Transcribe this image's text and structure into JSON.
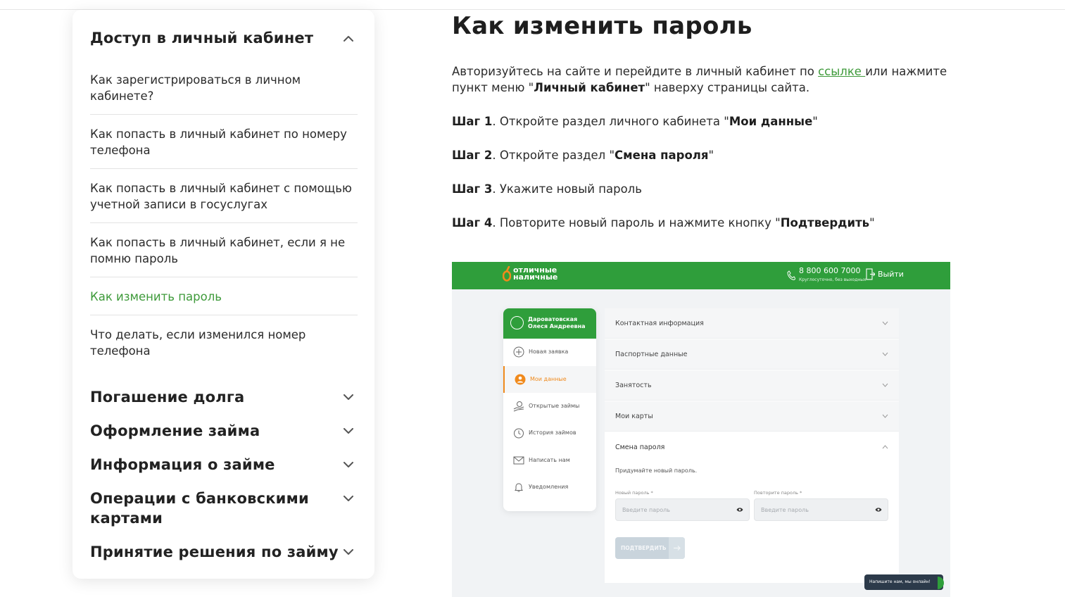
{
  "sidebar": {
    "sections": [
      {
        "title": "Доступ в личный кабинет",
        "expanded": true
      },
      {
        "title": "Погашение долга",
        "expanded": false
      },
      {
        "title": "Оформление займа",
        "expanded": false
      },
      {
        "title": "Информация о займе",
        "expanded": false
      },
      {
        "title": "Операции с банковскими картами",
        "expanded": false
      },
      {
        "title": "Принятие решения по займу",
        "expanded": false
      }
    ],
    "items": [
      {
        "label": "Как зарегистрироваться в личном кабинете?"
      },
      {
        "label": "Как попасть в личный кабинет по номеру телефона"
      },
      {
        "label": "Как попасть в личный кабинет с помощью учетной записи в госуслугах"
      },
      {
        "label": "Как попасть в личный кабинет, если я не помню пароль"
      },
      {
        "label": "Как изменить пароль",
        "active": true
      },
      {
        "label": "Что делать, если изменился номер телефона"
      }
    ]
  },
  "article": {
    "title": "Как изменить пароль",
    "intro_before_link": "Авторизуйтесь на сайте и перейдите в личный кабинет по ",
    "intro_link": "ссылке ",
    "intro_after_link": "или нажмите пункт меню \"",
    "intro_bold": "Личный кабинет",
    "intro_end": "\" наверху страницы сайта.",
    "steps": [
      {
        "label": "Шаг 1",
        "text_before": ". Откройте раздел личного кабинета \"",
        "bold": "Мои данные",
        "text_after": "\""
      },
      {
        "label": "Шаг 2",
        "text_before": ". Откройте раздел \"",
        "bold": "Смена пароля",
        "text_after": "\""
      },
      {
        "label": "Шаг 3",
        "text_before": ". Укажите новый пароль",
        "bold": "",
        "text_after": ""
      },
      {
        "label": "Шаг 4",
        "text_before": ". Повторите новый пароль и нажмите кнопку \"",
        "bold": "Подтвердить",
        "text_after": "\""
      }
    ]
  },
  "screenshot": {
    "logo_line1": "отличные",
    "logo_line2": "наличные",
    "phone": "8 800 600 7000",
    "phone_note": "Круглосуточно, без выходных",
    "logout": "Выйти",
    "user_line1": "Дароватовская",
    "user_line2": "Олеся Андреевна",
    "menu": [
      {
        "label": "Новая заявка",
        "icon": "plus-circle-icon"
      },
      {
        "label": "Мои данные",
        "icon": "user-icon",
        "active": true
      },
      {
        "label": "Открытые займы",
        "icon": "hand-coin-icon"
      },
      {
        "label": "История займов",
        "icon": "history-icon"
      },
      {
        "label": "Написать нам",
        "icon": "mail-icon"
      },
      {
        "label": "Уведомления",
        "icon": "bell-icon"
      }
    ],
    "accordion": [
      {
        "label": "Контактная информация"
      },
      {
        "label": "Паспортные данные"
      },
      {
        "label": "Занятость"
      },
      {
        "label": "Мои карты"
      },
      {
        "label": "Смена пароля",
        "open": true
      }
    ],
    "hint": "Придумайте новый пароль.",
    "new_pw_label": "Новый пароль *",
    "repeat_pw_label": "Повторите пароль *",
    "pw_placeholder": "Введите пароль",
    "confirm_button": "ПОДТВЕРДИТЬ",
    "chat_label": "Напишите нам, мы онлайн!",
    "colors": {
      "brand_green": "#2f9e3b",
      "accent_orange": "#f08a1c"
    }
  },
  "colors": {
    "link_green": "#3e9a3a"
  }
}
